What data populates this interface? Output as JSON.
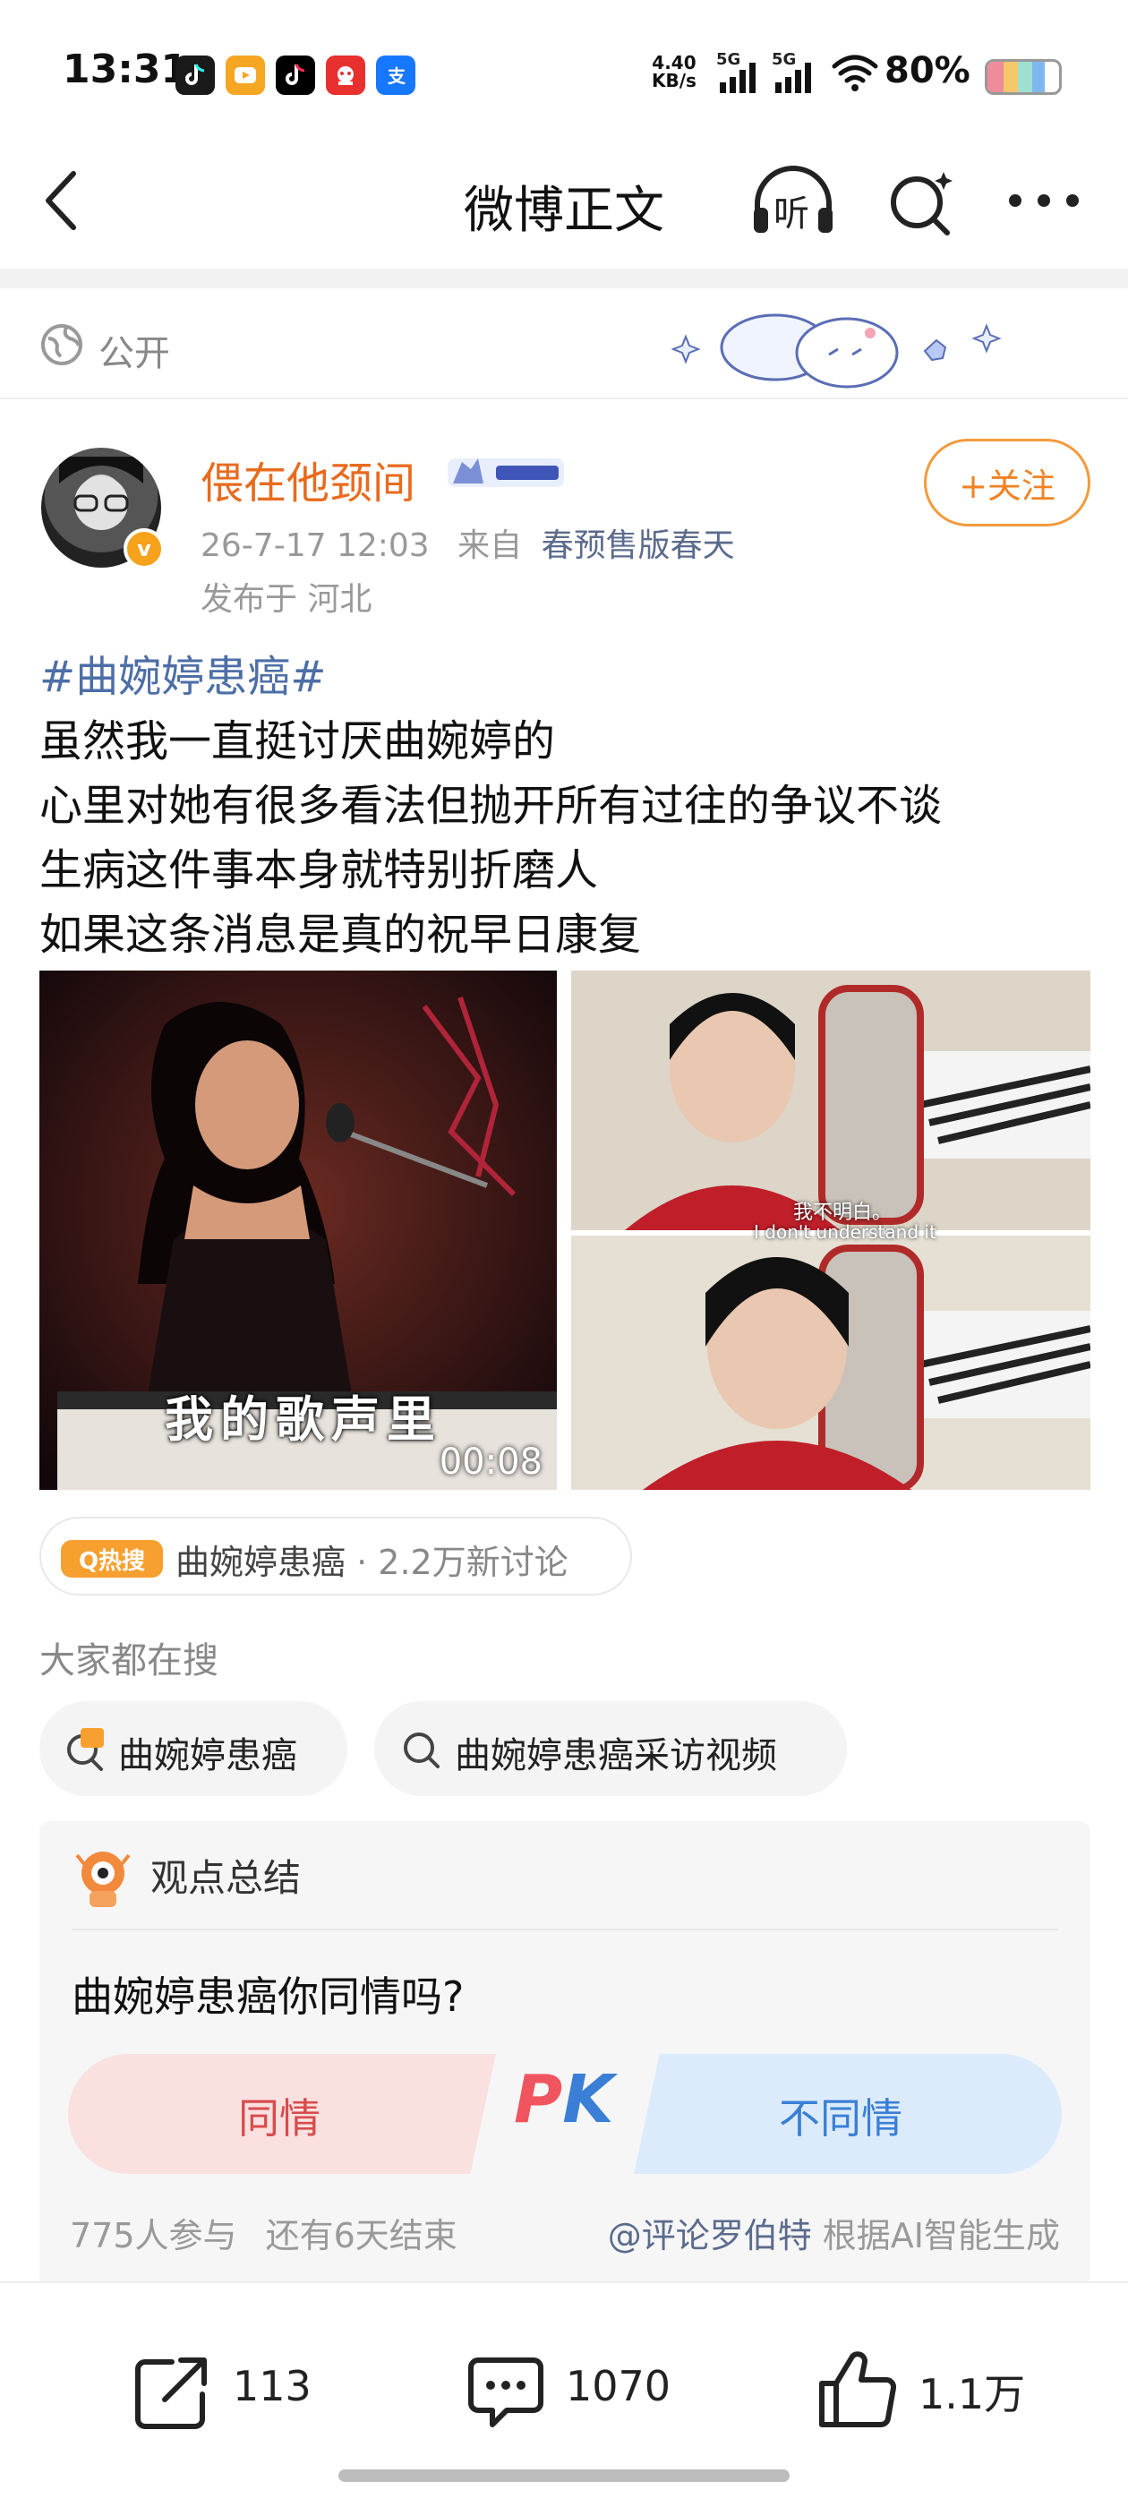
{
  "status_bar": {
    "time": "13:31",
    "net_speed_value": "4.40",
    "net_speed_unit": "KB/s",
    "signal1_label": "5G",
    "signal2_label": "5G",
    "battery_text": "80%",
    "app_icons": [
      "tiktok-lite-icon",
      "video-app-icon",
      "tiktok-icon",
      "gift-app-icon",
      "alipay-icon"
    ]
  },
  "header": {
    "title": "微博正文",
    "listen_label": "听"
  },
  "visibility": {
    "label": "公开"
  },
  "author": {
    "name": "偎在他颈间",
    "verified_badge": "v",
    "timestamp": "26-7-17 12:03",
    "source_prefix": "来自",
    "source": "春预售版春天",
    "location": "发布于 河北",
    "follow_label": "+关注"
  },
  "post": {
    "hashtag": "#曲婉婷患癌#",
    "lines": [
      "虽然我一直挺讨厌曲婉婷的",
      "心里对她有很多看法但抛开所有过往的争议不谈",
      "生病这件事本身就特别折磨人",
      "如果这条消息是真的祝早日康复"
    ]
  },
  "media": {
    "video_subtitle": "我的歌声里",
    "video_duration": "00:08",
    "photo_subtitle_cn": "我不明白。",
    "photo_subtitle_en": "I don't understand it"
  },
  "hot_search": {
    "badge": "Q热搜",
    "topic": "曲婉婷患癌",
    "count": "· 2.2万新讨论"
  },
  "everyone_search": {
    "heading": "大家都在搜",
    "chips": [
      "曲婉婷患癌",
      "曲婉婷患癌采访视频"
    ]
  },
  "viewpoint": {
    "title": "观点总结",
    "question": "曲婉婷患癌你同情吗?",
    "option_yes": "同情",
    "pk_label": "PK",
    "option_no": "不同情",
    "participants": "775人参与",
    "remaining": "还有6天结束",
    "attribution_user": "@评论罗伯特",
    "attribution_text": "根据AI智能生成"
  },
  "actions": {
    "repost_count": "113",
    "comment_count": "1070",
    "like_count": "1.1万"
  },
  "colors": {
    "username": "#e86b1e",
    "hashtag": "#4d6ea7",
    "follow": "#f08324",
    "yes": "#d84c4c",
    "no": "#3a7fd5",
    "hot_badge": "#f7a030"
  }
}
